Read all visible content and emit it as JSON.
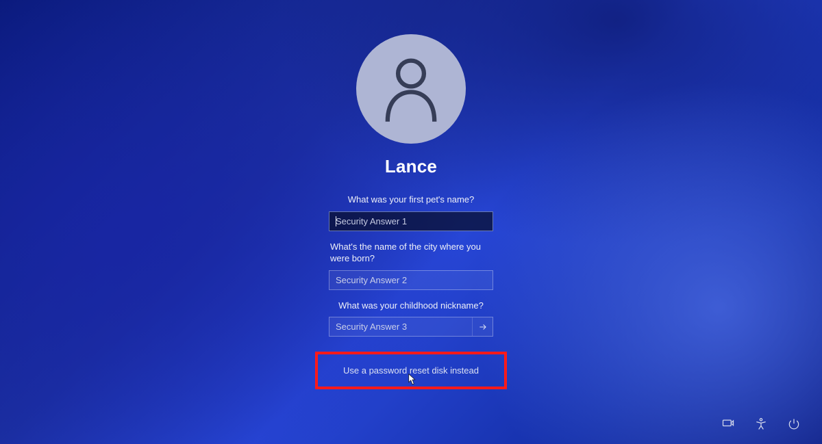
{
  "user": {
    "name": "Lance"
  },
  "questions": [
    {
      "prompt": "What was your first pet's name?",
      "placeholder": "Security Answer 1",
      "active": true,
      "hasSubmit": false
    },
    {
      "prompt": "What's the name of the city where you were born?",
      "placeholder": "Security Answer 2",
      "active": false,
      "hasSubmit": false
    },
    {
      "prompt": "What was your childhood nickname?",
      "placeholder": "Security Answer 3",
      "active": false,
      "hasSubmit": true
    }
  ],
  "altLink": "Use a password reset disk instead",
  "tray": {
    "network": "network-icon",
    "accessibility": "accessibility-icon",
    "power": "power-icon"
  },
  "highlightColor": "#ff1a1a"
}
